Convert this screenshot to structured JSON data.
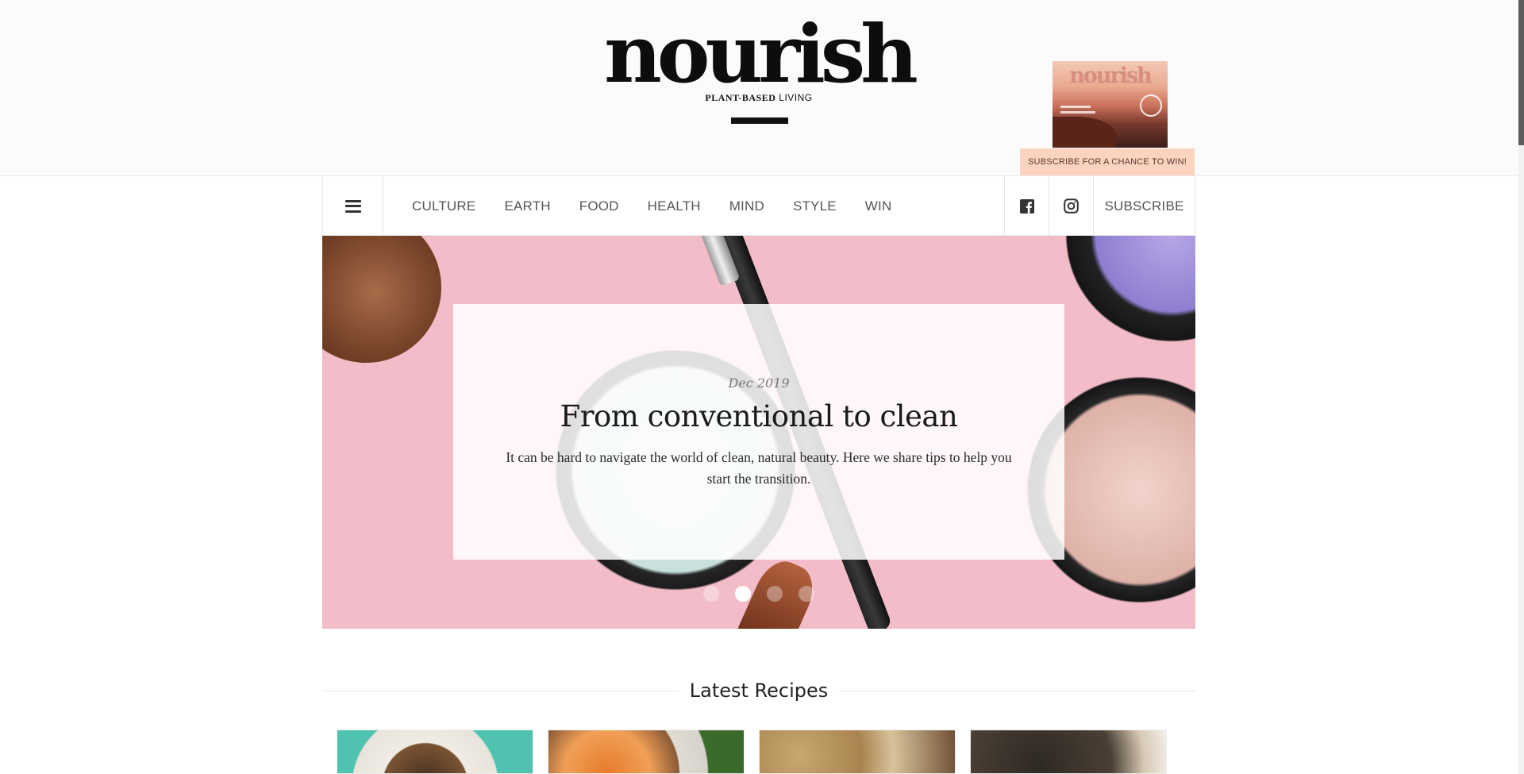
{
  "brand": {
    "logo": "nourish",
    "tagline_bold": "PLANT-BASED",
    "tagline_rest": "LIVING"
  },
  "promo": {
    "cover_title": "nourish",
    "strip_text": "SUBSCRIBE  FOR A CHANCE TO WIN!"
  },
  "nav": {
    "menu_icon": "hamburger-menu-icon",
    "items": [
      {
        "label": "CULTURE"
      },
      {
        "label": "EARTH"
      },
      {
        "label": "FOOD"
      },
      {
        "label": "HEALTH"
      },
      {
        "label": "MIND"
      },
      {
        "label": "STYLE"
      },
      {
        "label": "WIN"
      }
    ],
    "social": [
      {
        "icon": "facebook-icon"
      },
      {
        "icon": "instagram-icon"
      }
    ],
    "subscribe_label": "SUBSCRIBE"
  },
  "hero": {
    "date": "Dec 2019",
    "title": "From conventional to clean",
    "excerpt": "It can be hard to navigate the world of clean, natural beauty. Here we share tips to help you start the transition.",
    "slides_total": 4,
    "active_slide": 2
  },
  "latest_recipes": {
    "heading": "Latest Recipes",
    "items_visible": 4
  },
  "colors": {
    "hero_bg": "#f3bcc9",
    "promo_strip": "#fbd3bf",
    "header_bg": "#fbfbfb"
  }
}
